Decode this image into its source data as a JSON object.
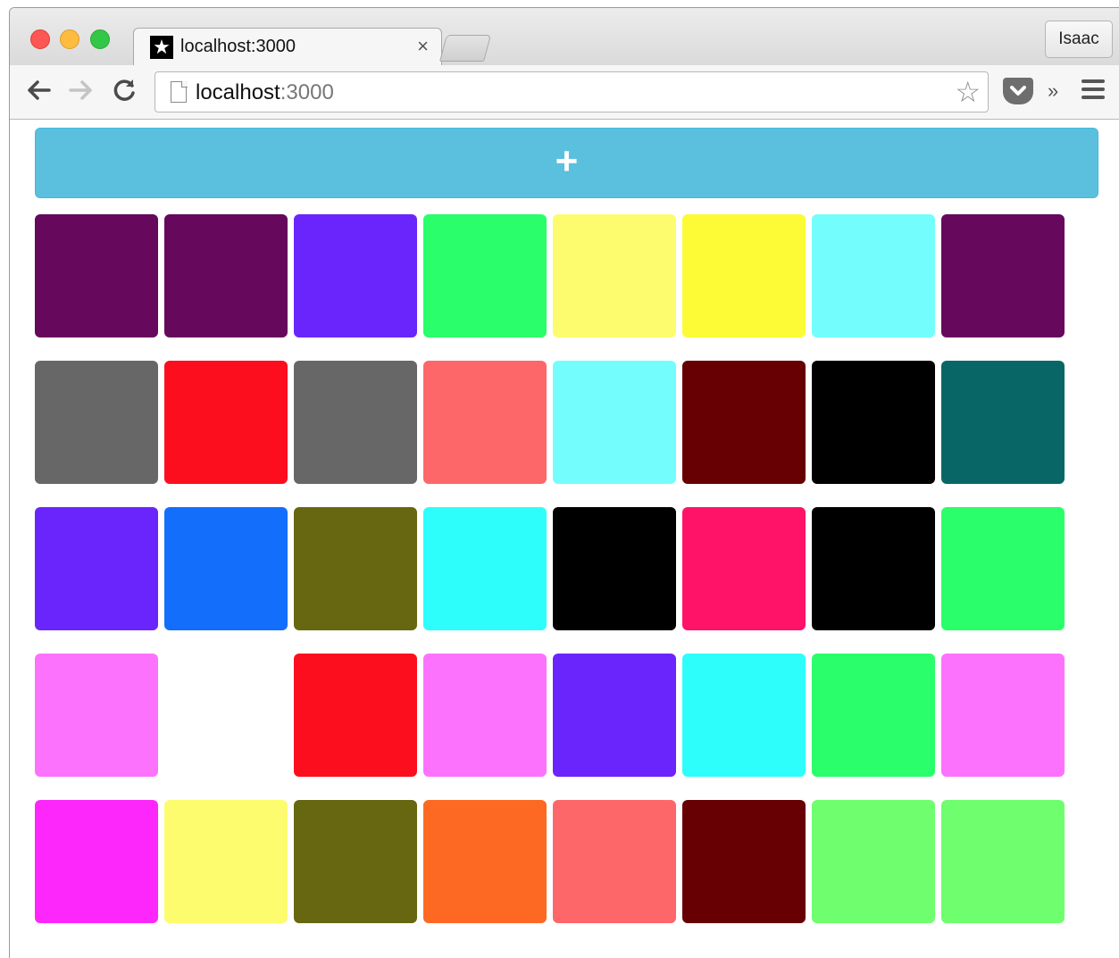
{
  "browser": {
    "tab": {
      "title": "localhost:3000",
      "favicon": "star-icon",
      "close_glyph": "×"
    },
    "profile_name": "Isaac",
    "address": {
      "host": "localhost",
      "port": ":3000"
    },
    "icons": {
      "back": "back-arrow-icon",
      "forward": "forward-arrow-icon",
      "reload": "reload-icon",
      "bookmark": "star-outline-icon",
      "pocket": "pocket-icon",
      "overflow": "chevron-double-right-icon",
      "menu": "hamburger-menu-icon"
    }
  },
  "page": {
    "add_button_label": "+",
    "add_button_color": "#5bc0de",
    "tile_rows": [
      [
        "#66085c",
        "#66085c",
        "#6a25fc",
        "#2bfe6b",
        "#fcfc6e",
        "#fcfb36",
        "#73fefd",
        "#66085c"
      ],
      [
        "#676767",
        "#fd0e1f",
        "#676767",
        "#fd6769",
        "#73fefd",
        "#670002",
        "#000000",
        "#086766"
      ],
      [
        "#6a25fc",
        "#136efc",
        "#676711",
        "#2dfefb",
        "#000000",
        "#fe1369",
        "#000000",
        "#2bfe6b"
      ],
      [
        "#fd72fd",
        "#ffffff",
        "#fd0e1f",
        "#fd72fd",
        "#6a25fc",
        "#2dfefb",
        "#2bfe6b",
        "#fd72fd"
      ],
      [
        "#fd27fc",
        "#fdfc6e",
        "#676711",
        "#fd6923",
        "#fd6769",
        "#670002",
        "#6efe6e",
        "#6efe6e"
      ]
    ]
  }
}
